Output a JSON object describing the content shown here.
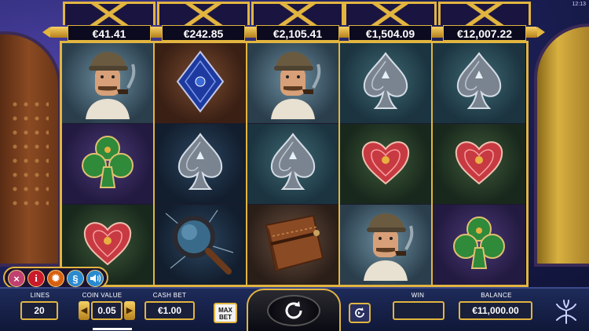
{
  "clock": "12:13",
  "jackpots": [
    "€41.41",
    "€242.85",
    "€2,105.41",
    "€1,504.09",
    "€12,007.22"
  ],
  "reels": [
    [
      {
        "symbol": "detective-icon",
        "bg": "bg-smoke"
      },
      {
        "symbol": "club-card-icon",
        "bg": "bg-purple"
      },
      {
        "symbol": "heart-card-icon",
        "bg": "bg-green"
      }
    ],
    [
      {
        "symbol": "diamond-card-icon",
        "bg": "bg-brown"
      },
      {
        "symbol": "spade-card-icon",
        "bg": "bg-navy"
      },
      {
        "symbol": "magnifying-glass-icon",
        "bg": "bg-navy"
      }
    ],
    [
      {
        "symbol": "detective-icon",
        "bg": "bg-smoke"
      },
      {
        "symbol": "spade-card-icon",
        "bg": "bg-teal"
      },
      {
        "symbol": "leather-book-icon",
        "bg": "bg-stone"
      }
    ],
    [
      {
        "symbol": "spade-card-icon",
        "bg": "bg-teal"
      },
      {
        "symbol": "heart-card-icon",
        "bg": "bg-green"
      },
      {
        "symbol": "detective-icon",
        "bg": "bg-smoke"
      }
    ],
    [
      {
        "symbol": "spade-card-icon",
        "bg": "bg-teal"
      },
      {
        "symbol": "heart-card-icon",
        "bg": "bg-green"
      },
      {
        "symbol": "club-card-icon",
        "bg": "bg-purple"
      }
    ]
  ],
  "side_controls": {
    "close": "×",
    "info": "i",
    "settings": "✹",
    "rules": "§",
    "sound": "◀)"
  },
  "bottom": {
    "lines_label": "LINES",
    "lines_value": "20",
    "coin_value_label": "COIN VALUE",
    "coin_value": "0.05",
    "coin_down": "◀",
    "coin_up": "▶",
    "cash_bet_label": "CASH BET",
    "cash_bet_value": "€1.00",
    "max_bet": "MAX BET",
    "win_label": "WIN",
    "win_value": "",
    "balance_label": "BALANCE",
    "balance_value": "€11,000.00"
  },
  "colors": {
    "gold": "#e2b540",
    "background": "#0d1330"
  }
}
